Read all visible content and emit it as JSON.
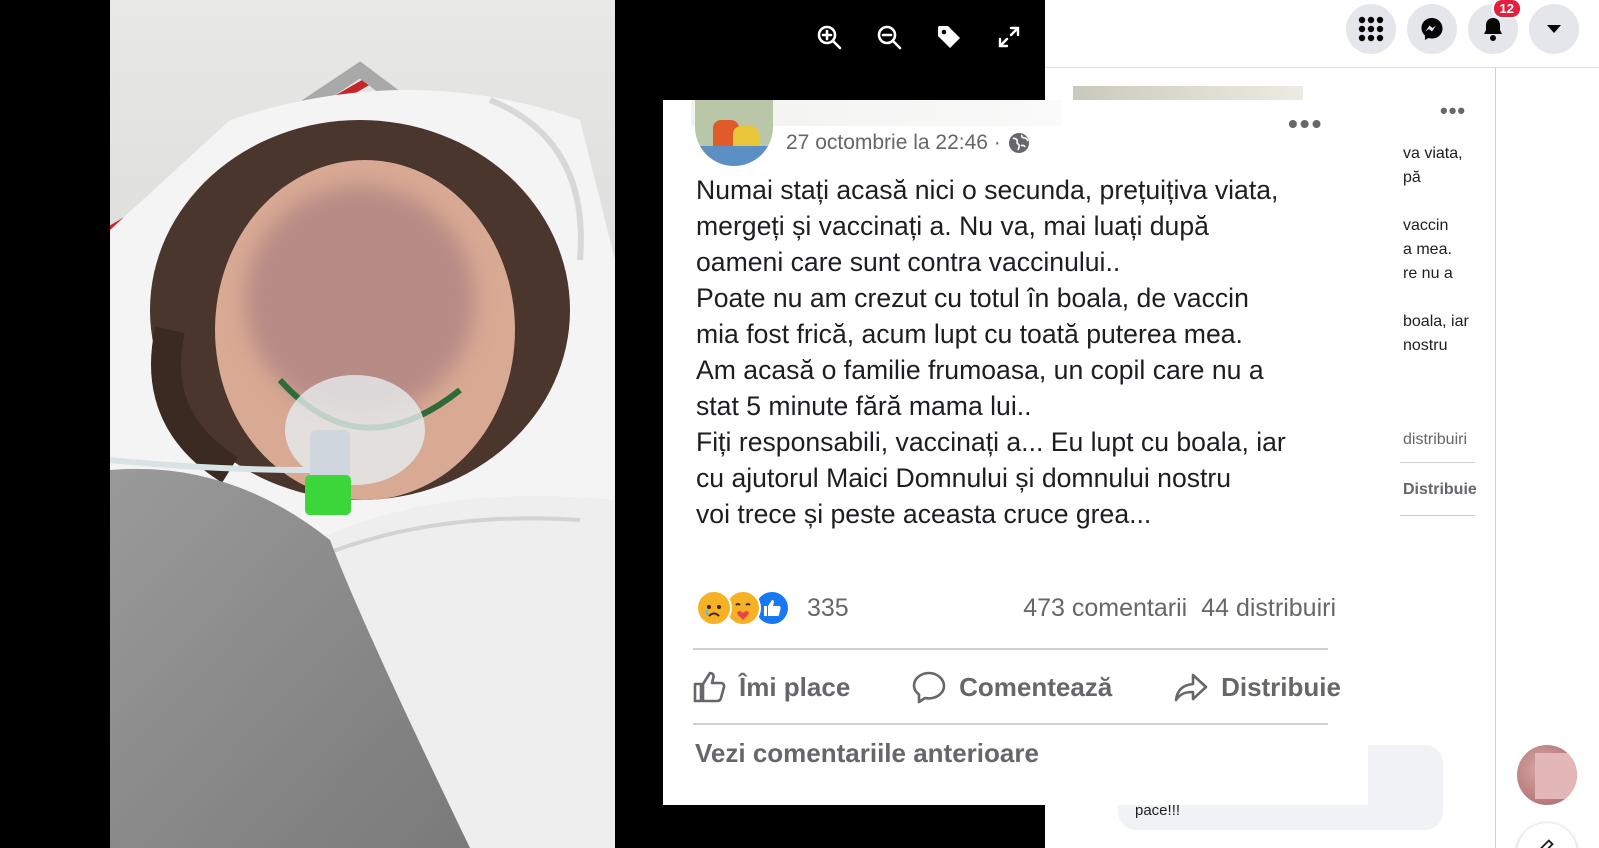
{
  "viewer": {
    "tools": [
      {
        "icon": "zoom-in-icon"
      },
      {
        "icon": "zoom-out-icon"
      },
      {
        "icon": "tag-icon"
      },
      {
        "icon": "fullscreen-icon"
      }
    ]
  },
  "topbar": {
    "notification_count": "12",
    "icons": [
      "menu-grid-icon",
      "messenger-icon",
      "bell-icon",
      "account-caret-icon"
    ]
  },
  "post": {
    "date": "27 octombrie la 22:46 ·",
    "lines": [
      "Numai stați acasă nici o secunda, prețuițiva viata,",
      "mergeți și vaccinați a. Nu va, mai luați după",
      "oameni care sunt contra vaccinului..",
      "Poate nu am crezut cu totul în boala, de vaccin",
      "mia fost frică, acum lupt cu toată puterea mea.",
      "Am acasă o familie frumoasa, un copil care nu a",
      "stat 5 minute fără mama lui..",
      "Fiți responsabili, vaccinați a... Eu lupt cu boala, iar",
      "cu ajutorul Maici Domnului și domnului nostru",
      "voi trece și peste aceasta cruce grea..."
    ],
    "reactions": {
      "count": "335",
      "types": [
        "sad-reaction-icon",
        "care-reaction-icon",
        "like-reaction-icon"
      ]
    },
    "comments": "473 comentarii",
    "shares": "44 distribuiri",
    "actions": {
      "like": "Îmi place",
      "comment": "Comentează",
      "share": "Distribuie"
    },
    "previous_comments": "Vezi comentariile anterioare"
  },
  "background": {
    "lines": [
      "va viata,",
      "pă",
      "vaccin",
      "a mea.",
      "re nu a",
      "boala, iar",
      "nostru"
    ],
    "shares": "distribuiri",
    "share_action": "Distribuie",
    "comment_snippet": "pace!!!"
  },
  "colors": {
    "text_primary": "#1c1e21",
    "text_secondary": "#65676b",
    "like_blue": "#1877f2",
    "badge_red": "#e41e3f"
  }
}
